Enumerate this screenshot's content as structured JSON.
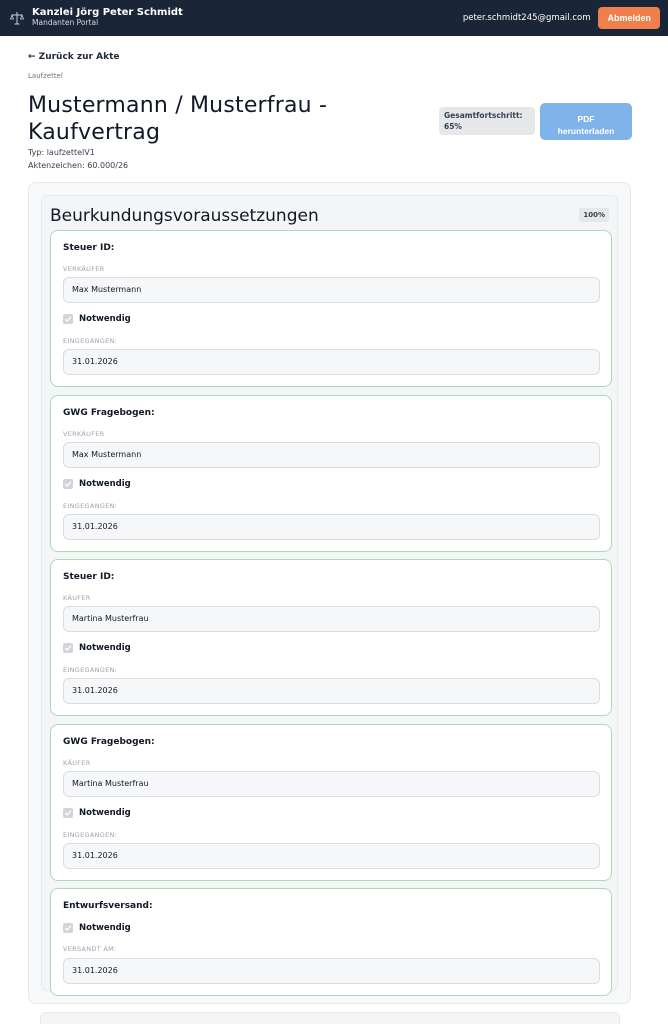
{
  "header": {
    "brand_title": "Kanzlei Jörg Peter Schmidt",
    "brand_subtitle": "Mandanten Portal",
    "email": "peter.schmidt245@gmail.com",
    "logout_label": "Abmelden"
  },
  "nav": {
    "back_label": "← Zurück zur Akte",
    "breadcrumb": "Laufzettel"
  },
  "file": {
    "title": "Mustermann / Musterfrau - Kaufvertrag",
    "type": "Typ: laufzettelV1",
    "aktenzeichen": "Aktenzeichen: 60.000/26",
    "progress_label": "Gesamtfortschritt:",
    "progress_value": "65%",
    "pdf_label_line1": "PDF",
    "pdf_label_line2": "herunterladen"
  },
  "section": {
    "title": "Beurkundungsvoraussetzungen",
    "percent": "100%",
    "cards": [
      {
        "title": "Steuer ID:",
        "party_label": "VERKÄUFER",
        "party_value": "Max Mustermann",
        "check_label": "Notwendig",
        "date_label": "EINGEGANGEN:",
        "date_value": "31.01.2026"
      },
      {
        "title": "GWG Fragebogen:",
        "party_label": "VERKÄUFER",
        "party_value": "Max Mustermann",
        "check_label": "Notwendig",
        "date_label": "EINGEGANGEN:",
        "date_value": "31.01.2026"
      },
      {
        "title": "Steuer ID:",
        "party_label": "KÄUFER",
        "party_value": "Martina Musterfrau",
        "check_label": "Notwendig",
        "date_label": "EINGEGANGEN:",
        "date_value": "31.01.2026"
      },
      {
        "title": "GWG Fragebogen:",
        "party_label": "KÄUFER",
        "party_value": "Martina Musterfrau",
        "check_label": "Notwendig",
        "date_label": "EINGEGANGEN:",
        "date_value": "31.01.2026"
      },
      {
        "title": "Entwurfsversand:",
        "check_label": "Notwendig",
        "date_label": "VERSANDT AM:",
        "date_value": "31.01.2026"
      }
    ]
  },
  "colors": {
    "topbar": "#1b2538",
    "logout": "#ef7f4b",
    "pdf_button": "#7fb3ea",
    "card_border": "#a9dcb5"
  }
}
